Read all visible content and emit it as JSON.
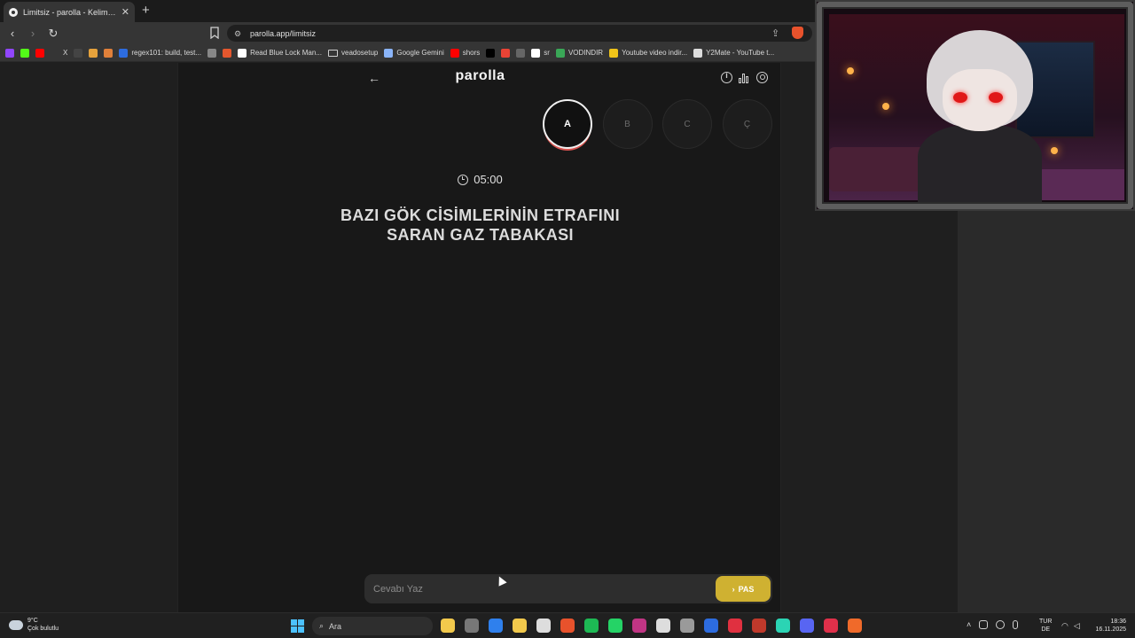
{
  "browser": {
    "tab_title": "Limitsiz - parolla - Kelime oyunu",
    "tab_close": "✕",
    "new_tab": "+",
    "url": "parolla.app/limitsiz",
    "bookmarks": [
      {
        "label": "",
        "color": "#9146ff"
      },
      {
        "label": "",
        "color": "#53fc18"
      },
      {
        "label": "",
        "color": "#ff0000"
      },
      {
        "label": "X",
        "color": ""
      },
      {
        "label": "",
        "color": "#444444"
      },
      {
        "label": "",
        "color": "#e6a23c"
      },
      {
        "label": "",
        "color": "#e0803a"
      },
      {
        "label": "regex101: build, test...",
        "color": "#2d6cdf"
      },
      {
        "label": "",
        "color": "#888888"
      },
      {
        "label": "",
        "color": "#e4572e"
      },
      {
        "label": "Read Blue Lock Man...",
        "color": "#ffffff"
      },
      {
        "label": "veadosetup",
        "color": "folder"
      },
      {
        "label": "Google Gemini",
        "color": "#8ab4f8"
      },
      {
        "label": "shors",
        "color": "#ff0000"
      },
      {
        "label": "",
        "color": "#000000"
      },
      {
        "label": "",
        "color": "#ea4335"
      },
      {
        "label": "",
        "color": "#666666"
      },
      {
        "label": "sr",
        "color": "#ffffff"
      },
      {
        "label": "VODINDIR",
        "color": "#3aa757"
      },
      {
        "label": "Youtube video indir...",
        "color": "#f0c419"
      },
      {
        "label": "Y2Mate - YouTube t...",
        "color": "#dddddd"
      }
    ]
  },
  "app": {
    "title": "parolla",
    "letters": [
      "A",
      "B",
      "C",
      "Ç"
    ],
    "active_letter_index": 0,
    "timer": "05:00",
    "question_line1": "BAZI GÖK CİSİMLERİNİN ETRAFINI",
    "question_line2": "SARAN GAZ TABAKASI",
    "answer_placeholder": "Cevabı Yaz",
    "pass_label": "PAS",
    "pass_chevron": "›",
    "accent_color": "#cfb131"
  },
  "taskbar": {
    "weather_temp": "9°C",
    "weather_desc": "Çok bulutlu",
    "search_label": "Ara",
    "lang_top": "TUR",
    "lang_bottom": "DE",
    "time": "18:36",
    "date": "16.11.2025",
    "apps": [
      "#f2c94c",
      "#777777",
      "#2f80ed",
      "#f2c94c",
      "#dddddd",
      "#e8522c",
      "#1db954",
      "#25d366",
      "#c13584",
      "#dddddd",
      "#9a9a9a",
      "#2d6cdf",
      "#e03040",
      "#c0392b",
      "#2bd4b4",
      "#5865f2",
      "#e0304a",
      "#f06a2a"
    ]
  }
}
